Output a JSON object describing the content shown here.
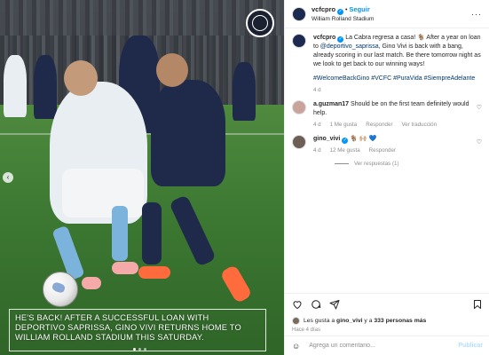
{
  "post": {
    "caption_overlay": "HE'S BACK! AFTER A SUCCESSFUL LOAN WITH DEPORTIVO SAPRISSA, GINO VIVI RETURNS HOME TO WILLIAM ROLLAND STADIUM THIS SATURDAY."
  },
  "header": {
    "username": "vcfcpro",
    "verified_symbol": "✓",
    "separator": "•",
    "follow_label": "Seguir",
    "location": "William Rolland Stadium",
    "more_icon": "more-horizontal-icon"
  },
  "caption_comment": {
    "username": "vcfcpro",
    "text_before": " La Cabra regresa a casa! 🐐 After a year on loan to ",
    "mention": "@deportivo_saprissa",
    "text_after": ", Gino Vivi is back with a bang, already scoring in our last match. Be there tomorrow night as we look to get back to our winning ways!",
    "hashtags": "#WelcomeBackGino #VCFC #PuraVida #SiempreAdelante",
    "time": "4 d"
  },
  "comments": [
    {
      "username": "a.guzman17",
      "text": " Should be on the first team definitely would help.",
      "time": "4 d",
      "likes": "1 Me gusta",
      "reply": "Responder",
      "translate": "Ver traducción"
    },
    {
      "username": "gino_vivi",
      "verified_symbol": "✓",
      "text": " 🐐 🙌🏼 💙",
      "time": "4 d",
      "likes": "12 Me gusta",
      "reply": "Responder",
      "view_replies": "Ver respuestas (1)"
    }
  ],
  "actions": {
    "liked_by_prefix": "Les gusta a ",
    "liked_by_user": "gino_vivi",
    "liked_by_connector": " y a ",
    "liked_by_count": "333 personas más",
    "posted_ago": "Hace 4 días"
  },
  "add_comment": {
    "placeholder": "Agrega un comentario...",
    "publish_label": "Publicar"
  },
  "colors": {
    "accent_blue": "#0095f6",
    "link_blue": "#00376b",
    "muted": "#8e8e8e"
  }
}
